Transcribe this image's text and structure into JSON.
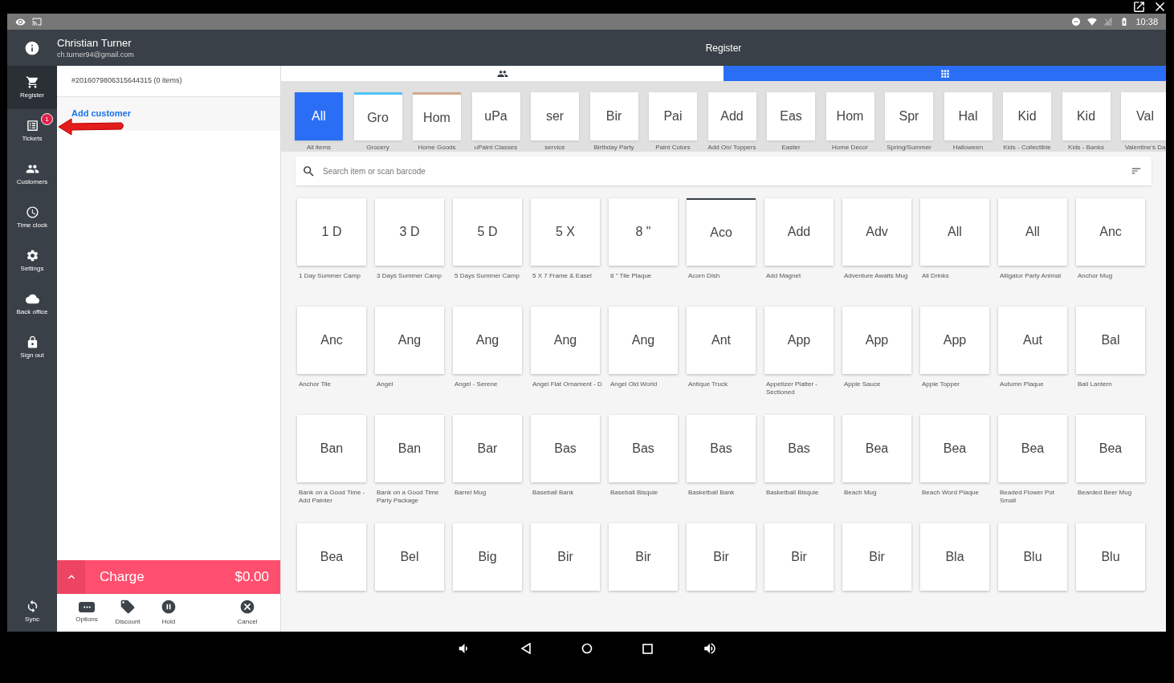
{
  "status_bar": {
    "time": "10:38"
  },
  "header": {
    "user_name": "Christian Turner",
    "email": "ch.turner94@gmail.com",
    "title": "Register"
  },
  "sidebar": {
    "items": [
      {
        "kind": "register",
        "label": "Register",
        "selected": true
      },
      {
        "kind": "tickets",
        "label": "Tickets",
        "selected": false,
        "badge": "1"
      },
      {
        "kind": "customers",
        "label": "Customers",
        "selected": false
      },
      {
        "kind": "timeclock",
        "label": "Time clock",
        "selected": false
      },
      {
        "kind": "settings",
        "label": "Settings",
        "selected": false
      },
      {
        "kind": "backoffice",
        "label": "Back office",
        "selected": false
      },
      {
        "kind": "signout",
        "label": "Sign out",
        "selected": false
      }
    ],
    "sync": {
      "label": "Sync"
    }
  },
  "ticket": {
    "number": "#2016079806315644315 (0 items)",
    "add_customer": "Add customer",
    "charge_label": "Charge",
    "total": "$0.00",
    "actions": [
      {
        "kind": "options",
        "label": "Options"
      },
      {
        "kind": "discount",
        "label": "Discount"
      },
      {
        "kind": "hold",
        "label": "Hold"
      },
      {
        "kind": "cancel",
        "label": "Cancel"
      }
    ]
  },
  "tabs": [
    {
      "kind": "customers",
      "selected": false
    },
    {
      "kind": "grid",
      "selected": true
    }
  ],
  "categories": [
    {
      "abbr": "All",
      "label": "All items",
      "selected": true
    },
    {
      "abbr": "Gro",
      "label": "Grocery",
      "selected": false,
      "color": "#4fc3f7"
    },
    {
      "abbr": "Hom",
      "label": "Home Goods",
      "selected": false,
      "color": "#d4a98e"
    },
    {
      "abbr": "uPa",
      "label": "uPaint Classes",
      "selected": false
    },
    {
      "abbr": "ser",
      "label": "service",
      "selected": false
    },
    {
      "abbr": "Bir",
      "label": "Birthday Party",
      "selected": false
    },
    {
      "abbr": "Pai",
      "label": "Paint Colors",
      "selected": false
    },
    {
      "abbr": "Add",
      "label": "Add On/ Toppers",
      "selected": false
    },
    {
      "abbr": "Eas",
      "label": "Easter",
      "selected": false
    },
    {
      "abbr": "Hom",
      "label": "Home Decor",
      "selected": false
    },
    {
      "abbr": "Spr",
      "label": "Spring/Summer",
      "selected": false
    },
    {
      "abbr": "Hal",
      "label": "Halloween",
      "selected": false
    },
    {
      "abbr": "Kid",
      "label": "Kids - Collectible",
      "selected": false
    },
    {
      "abbr": "Kid",
      "label": "Kids - Banks",
      "selected": false
    },
    {
      "abbr": "Val",
      "label": "Valentine's Da",
      "selected": false
    }
  ],
  "search": {
    "placeholder": "Search item or scan barcode"
  },
  "items": [
    {
      "abbr": "1 D",
      "name": "1 Day Summer Camp",
      "selected": false
    },
    {
      "abbr": "3 D",
      "name": "3 Days Summer Camp",
      "selected": false
    },
    {
      "abbr": "5 D",
      "name": "5 Days Summer Camp",
      "selected": false
    },
    {
      "abbr": "5 X",
      "name": "5 X 7 Frame & Easel",
      "selected": false
    },
    {
      "abbr": "8 \"",
      "name": "8 \" Tile Plaque",
      "selected": false
    },
    {
      "abbr": "Aco",
      "name": "Acorn Dish",
      "selected": true
    },
    {
      "abbr": "Add",
      "name": "Add Magnet",
      "selected": false
    },
    {
      "abbr": "Adv",
      "name": "Adventure Awaits Mug",
      "selected": false
    },
    {
      "abbr": "All",
      "name": "All Drinks",
      "selected": false
    },
    {
      "abbr": "All",
      "name": "Alligator Party Animal",
      "selected": false
    },
    {
      "abbr": "Anc",
      "name": "Anchor Mug",
      "selected": false
    },
    {
      "abbr": "Anc",
      "name": "Anchor Tile",
      "selected": false
    },
    {
      "abbr": "Ang",
      "name": "Angel",
      "selected": false
    },
    {
      "abbr": "Ang",
      "name": "Angel - Serene",
      "selected": false
    },
    {
      "abbr": "Ang",
      "name": "Angel Flat Ornament - D",
      "selected": false
    },
    {
      "abbr": "Ang",
      "name": "Angel Old World",
      "selected": false
    },
    {
      "abbr": "Ant",
      "name": "Antique Truck",
      "selected": false
    },
    {
      "abbr": "App",
      "name": "Appetizer Platter - Sectioned",
      "selected": false
    },
    {
      "abbr": "App",
      "name": "Apple Sauce",
      "selected": false
    },
    {
      "abbr": "App",
      "name": "Apple Topper",
      "selected": false
    },
    {
      "abbr": "Aut",
      "name": "Autumn Plaque",
      "selected": false
    },
    {
      "abbr": "Bal",
      "name": "Ball Lantern",
      "selected": false
    },
    {
      "abbr": "Ban",
      "name": "Bank on a Good Time - Add Painter",
      "selected": false
    },
    {
      "abbr": "Ban",
      "name": "Bank on a Good Time Party Package",
      "selected": false
    },
    {
      "abbr": "Bar",
      "name": "Barrel Mug",
      "selected": false
    },
    {
      "abbr": "Bas",
      "name": "Baseball Bank",
      "selected": false
    },
    {
      "abbr": "Bas",
      "name": "Baseball Bisquie",
      "selected": false
    },
    {
      "abbr": "Bas",
      "name": "Basketball Bank",
      "selected": false
    },
    {
      "abbr": "Bas",
      "name": "Basketball Bisquie",
      "selected": false
    },
    {
      "abbr": "Bea",
      "name": "Beach Mug",
      "selected": false
    },
    {
      "abbr": "Bea",
      "name": "Beach Word Plaque",
      "selected": false
    },
    {
      "abbr": "Bea",
      "name": "Beaded Flower Pot Small",
      "selected": false
    },
    {
      "abbr": "Bea",
      "name": "Bearded Beer Mug",
      "selected": false
    },
    {
      "abbr": "Bea",
      "selected": false
    },
    {
      "abbr": "Bel",
      "selected": false
    },
    {
      "abbr": "Big",
      "selected": false
    },
    {
      "abbr": "Bir",
      "selected": false
    },
    {
      "abbr": "Bir",
      "selected": false
    },
    {
      "abbr": "Bir",
      "selected": false
    },
    {
      "abbr": "Bir",
      "selected": false
    },
    {
      "abbr": "Bir",
      "selected": false
    },
    {
      "abbr": "Bla",
      "selected": false
    },
    {
      "abbr": "Blu",
      "selected": false
    },
    {
      "abbr": "Blu",
      "selected": false
    }
  ]
}
